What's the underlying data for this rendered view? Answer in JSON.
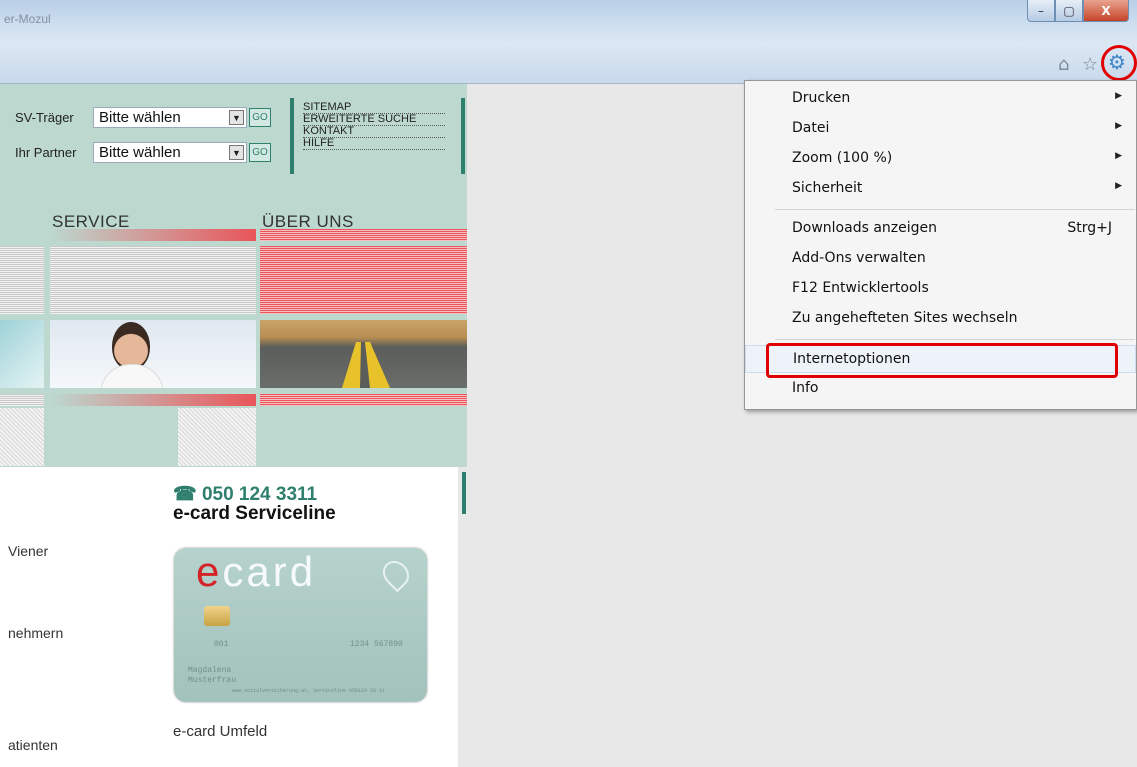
{
  "window": {
    "title": "er-Mozul",
    "controls": [
      "–",
      "▢",
      "X"
    ]
  },
  "toolbar_icons": [
    "home-icon",
    "star-icon",
    "gear-icon"
  ],
  "page": {
    "selectors": [
      {
        "label": "SV-Träger",
        "value": "Bitte wählen",
        "go": "GO"
      },
      {
        "label": "Ihr Partner",
        "value": "Bitte wählen",
        "go": "GO"
      }
    ],
    "top_links": [
      "SITEMAP",
      "ERWEITERTE SUCHE",
      "KONTAKT",
      "HILFE"
    ],
    "nav": [
      "SERVICE",
      "ÜBER UNS"
    ],
    "phone": "☎ 050 124 3311",
    "serviceline": "e-card Serviceline",
    "left_fragments": [
      "Viener",
      "nehmern",
      "atienten"
    ],
    "umfeld": "e-card Umfeld",
    "card": {
      "logo_e": "e",
      "logo_rest": "card",
      "num_left": "001",
      "num_right": "1234 567890",
      "name1": "Magdalena",
      "name2": "Musterfrau",
      "footer": "www.sozialversicherung.at, Serviceline 050124 33 11"
    }
  },
  "menu": {
    "groups": [
      [
        {
          "label": "Drucken",
          "submenu": true
        },
        {
          "label": "Datei",
          "submenu": true
        },
        {
          "label": "Zoom (100 %)",
          "submenu": true
        },
        {
          "label": "Sicherheit",
          "submenu": true
        }
      ],
      [
        {
          "label": "Downloads anzeigen",
          "shortcut": "Strg+J"
        },
        {
          "label": "Add-Ons verwalten"
        },
        {
          "label": "F12 Entwicklertools"
        },
        {
          "label": "Zu angehefteten Sites wechseln"
        }
      ],
      [
        {
          "label": "Internetoptionen",
          "highlighted": true
        },
        {
          "label": "Info"
        }
      ]
    ],
    "arrow": "▶"
  },
  "colors": {
    "accent_green": "#2e7f6d",
    "band": "#bcd8cf",
    "highlight_red": "#e00000"
  }
}
